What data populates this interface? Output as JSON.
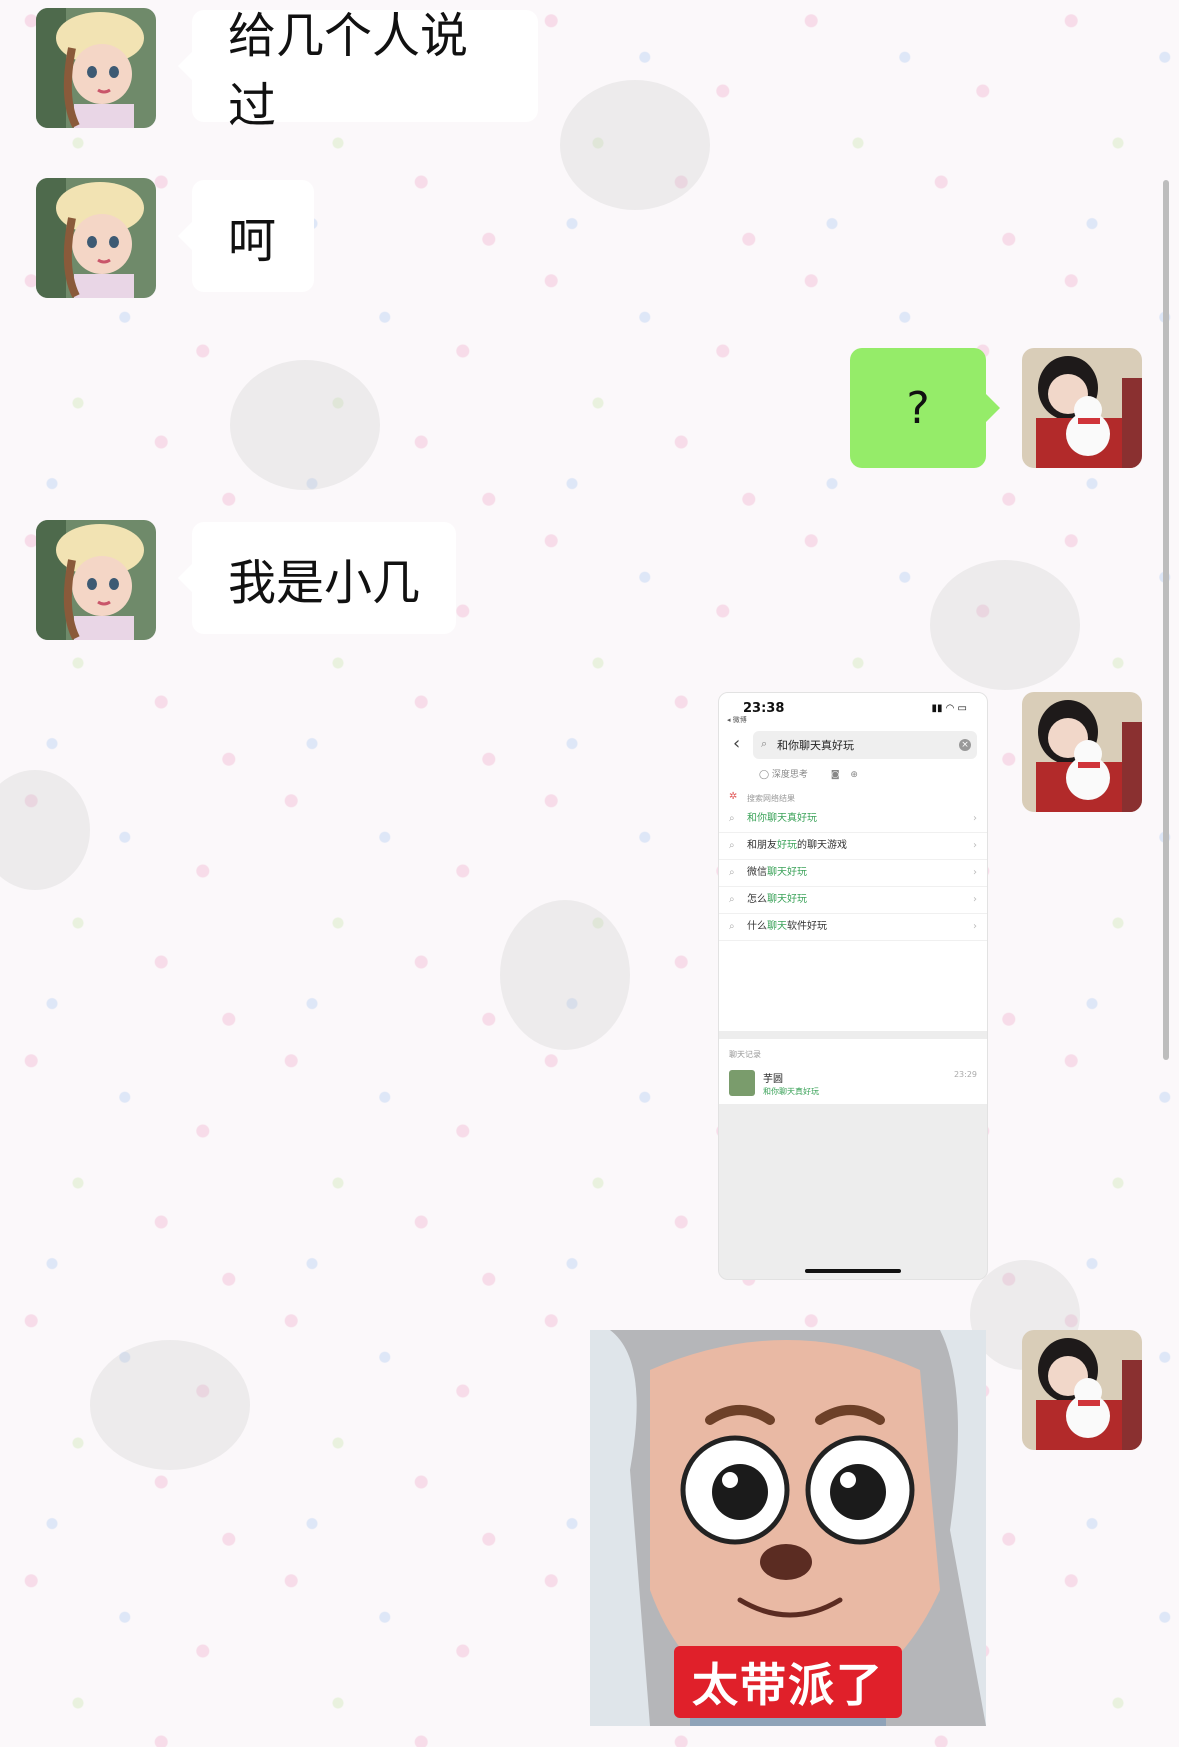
{
  "messages": {
    "m1": {
      "text": "给几个人说过"
    },
    "m2": {
      "text": "呵"
    },
    "m3": {
      "text": "?"
    },
    "m4": {
      "text": "我是小几"
    }
  },
  "screenshot": {
    "time": "23:38",
    "carrier": "◂ 微博",
    "search_query": "和你聊天真好玩",
    "deep_think": "◯ 深度思考",
    "section_title": "搜索网络结果",
    "suggestions": [
      {
        "pre": "",
        "hl": "和你聊天真好玩",
        "post": ""
      },
      {
        "pre": "和朋友",
        "hl": "好玩",
        "post": "的聊天游戏"
      },
      {
        "pre": "微信",
        "hl": "聊天好玩",
        "post": ""
      },
      {
        "pre": "怎么",
        "hl": "聊天好玩",
        "post": ""
      },
      {
        "pre": "什么",
        "hl": "聊天",
        "post": "软件好玩"
      }
    ],
    "chat_section": "聊天记录",
    "chat_name": "芋圆",
    "chat_msg": "和你聊天真好玩",
    "chat_time": "23:29"
  },
  "sticker": {
    "caption": "太带派了"
  },
  "colors": {
    "green_bubble": "#95ec69",
    "caption_red": "#e0202a"
  }
}
